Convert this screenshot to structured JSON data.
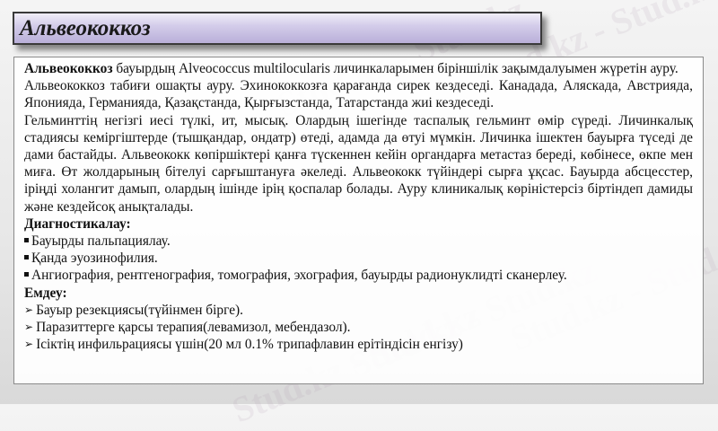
{
  "title": "Альвеококкоз",
  "watermark_text": "Stud.kz - Stud.kz",
  "paragraphs": {
    "p1_bold": "Альвеококкоз",
    "p1_rest": " бауырдың Alveococcus multilocularis личинкаларымен біріншілік зақымдалуымен жүретін ауру.",
    "p2": "Альвеококкоз табиғи ошақты ауру. Эхинококкозға қарағанда сирек кездеседі. Канадада, Аляскада, Австрияда, Японияда, Германияда, Қазақстанда, Қырғызстанда, Татарстанда жиі кездеседі.",
    "p3": "Гельминттің негізгі иесі түлкі, ит, мысық. Олардың ішегінде таспалық гельминт өмір сүреді. Личинкалық стадиясы кеміргіштерде (тышқандар, ондатр) өтеді, адамда да өтуі мүмкін. Личинка ішектен бауырға түседі де дами бастайды. Альвеококк көпіршіктері қанға түскеннен кейін органдарға метастаз береді, көбінесе, өкпе мен миға. Өт жолдарының бітелуі сарғыштануға әкеледі. Альвеококк түйіндері сырға ұқсас. Бауырда абсцесстер, іріңді холангит дамып, олардың ішінде ірің қоспалар болады. Ауру клиникалық көріністерсіз біртіндеп дамиды және кездейсоқ анықталады."
  },
  "diagnostics": {
    "heading": "Диагностикалау:",
    "items": [
      "Бауырды пальпациялау.",
      "Қанда эуозинофилия.",
      "Ангиография, рентгенография, томография, эхография, бауырды радионуклидті сканерлеу."
    ]
  },
  "treatment": {
    "heading": "Емдеу:",
    "items": [
      "Бауыр резекциясы(түйінмен бірге).",
      "Паразиттерге қарсы терапия(левамизол, мебендазол).",
      "Ісіктің инфильрациясы үшін(20 мл 0.1% трипафлавин ерітіндісін енгізу)"
    ]
  }
}
